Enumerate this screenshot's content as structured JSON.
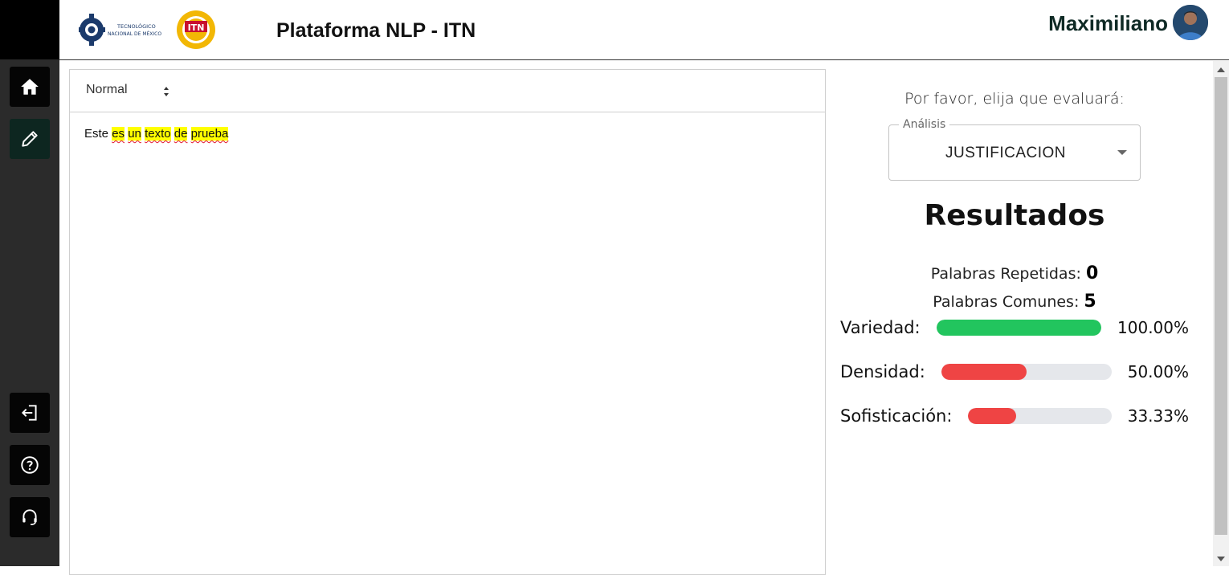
{
  "header": {
    "title": "Plataforma NLP - ITN",
    "user_name": "Maximiliano",
    "logo_tec_text_line1": "TECNOLÓGICO",
    "logo_tec_text_line2": "NACIONAL DE MÉXICO",
    "logo_itn_text": "ITN"
  },
  "sidebar": {
    "items": [
      {
        "name": "home",
        "icon": "home-icon"
      },
      {
        "name": "edit",
        "icon": "pencil-icon",
        "active": true
      },
      {
        "name": "logout",
        "icon": "logout-icon"
      },
      {
        "name": "help",
        "icon": "help-icon"
      },
      {
        "name": "support",
        "icon": "headset-icon"
      }
    ]
  },
  "editor": {
    "format_value": "Normal",
    "words": [
      {
        "text": "Este",
        "highlight": false
      },
      {
        "text": "es",
        "highlight": true
      },
      {
        "text": "un",
        "highlight": true
      },
      {
        "text": "texto",
        "highlight": true
      },
      {
        "text": "de",
        "highlight": true
      },
      {
        "text": "prueba",
        "highlight": true
      }
    ]
  },
  "panel": {
    "prompt": "Por favor, elija que evaluará:",
    "analysis_label": "Análisis",
    "analysis_value": "JUSTIFICACION",
    "results_title": "Resultados",
    "repeated_label": "Palabras Repetidas:",
    "repeated_value": "0",
    "common_label": "Palabras Comunes:",
    "common_value": "5",
    "metrics": [
      {
        "label": "Variedad:",
        "value": "100.00%",
        "percent": 100,
        "color": "#22c55e"
      },
      {
        "label": "Densidad:",
        "value": "50.00%",
        "percent": 50,
        "color": "#ef4444"
      },
      {
        "label": "Sofisticación:",
        "value": "33.33%",
        "percent": 33.33,
        "color": "#ef4444"
      }
    ]
  },
  "colors": {
    "sidebar_bg": "#2b2b2b",
    "highlight": "#ffff00",
    "good": "#22c55e",
    "bad": "#ef4444"
  }
}
